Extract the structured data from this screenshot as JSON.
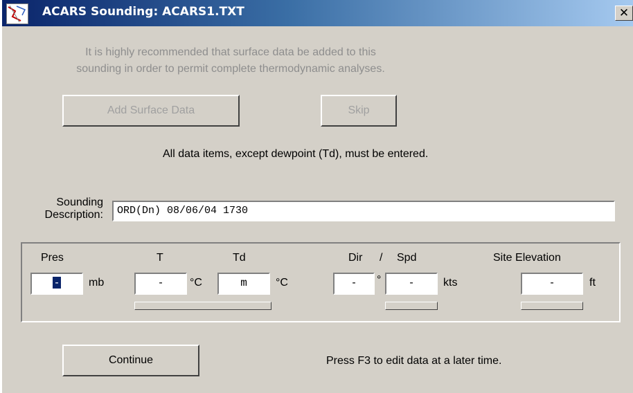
{
  "window": {
    "title": "ACARS Sounding:  ACARS1.TXT",
    "close_glyph": "✕",
    "app_icon": "acars-map-icon"
  },
  "notice": {
    "line1": "It is highly recommended that surface data be added to this",
    "line2": "sounding in order to permit complete thermodynamic analyses."
  },
  "buttons": {
    "add_surface": "Add Surface Data",
    "skip": "Skip",
    "continue": "Continue"
  },
  "required_note": "All data items, except dewpoint (Td), must be entered.",
  "description": {
    "label_line1": "Sounding",
    "label_line2": "Description:",
    "value": "ORD(Dn) 08/06/04 1730"
  },
  "fields": {
    "pres": {
      "label": "Pres",
      "value": "-",
      "unit": "mb"
    },
    "t": {
      "label": "T",
      "value": "-",
      "unit": "°C"
    },
    "td": {
      "label": "Td",
      "value": "m",
      "unit": "°C"
    },
    "dir": {
      "label": "Dir",
      "value": "-",
      "unit": "°"
    },
    "slash": "/",
    "spd": {
      "label": "Spd",
      "value": "-",
      "unit": "kts"
    },
    "elev": {
      "label": "Site Elevation",
      "value": "-",
      "unit": "ft"
    }
  },
  "later_note": "Press F3 to edit data at a later time.",
  "colors": {
    "face": "#d4d0c8",
    "title_start": "#0a246a",
    "title_end": "#a6caf0",
    "disabled_text": "#8e8e8e",
    "selection": "#0a246a"
  }
}
